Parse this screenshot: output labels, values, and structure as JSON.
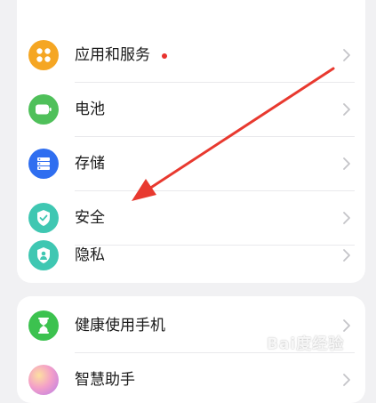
{
  "settings_group_1": {
    "items": [
      {
        "label": "应用和服务",
        "icon": "apps-icon",
        "color": "#f5a623",
        "has_badge": true,
        "badge_color": "#e8322e"
      },
      {
        "label": "电池",
        "icon": "battery-icon",
        "color": "#4fc05a"
      },
      {
        "label": "存储",
        "icon": "storage-icon",
        "color": "#2f6ef0"
      },
      {
        "label": "安全",
        "icon": "shield-icon",
        "color": "#3fc7b2"
      },
      {
        "label": "隐私",
        "icon": "privacy-icon",
        "color": "#3fc7b2"
      }
    ]
  },
  "settings_group_2": {
    "items": [
      {
        "label": "健康使用手机",
        "icon": "hourglass-icon",
        "color": "#3cc24f"
      },
      {
        "label": "智慧助手",
        "icon": "assistant-icon",
        "color": "#d77be0"
      }
    ]
  },
  "annotation": {
    "arrow_color": "#e8392f"
  },
  "watermark": {
    "text": "Bai度经验"
  }
}
